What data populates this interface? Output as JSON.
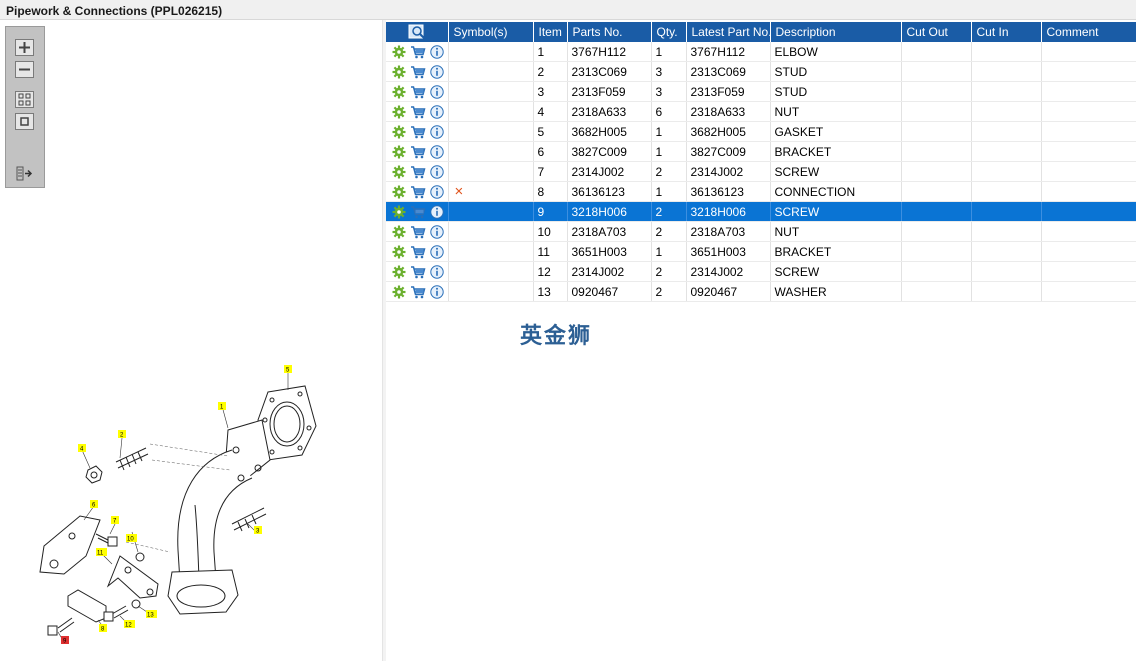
{
  "window": {
    "title": "Pipework & Connections (PPL026215)"
  },
  "toolbar": {
    "zoom_in_icon": "plus-icon",
    "zoom_out_icon": "minus-icon",
    "fit_icon": "grid-icon",
    "actual_icon": "square-icon",
    "export_icon": "export-icon"
  },
  "grid": {
    "headers": [
      "",
      "Symbol(s)",
      "Item",
      "Parts No.",
      "Qty.",
      "Latest Part No.",
      "Description",
      "Cut Out",
      "Cut In",
      "Comment"
    ],
    "rows": [
      {
        "symbol": "",
        "item": "1",
        "part": "3767H112",
        "qty": "1",
        "latest": "3767H112",
        "desc": "ELBOW"
      },
      {
        "symbol": "",
        "item": "2",
        "part": "2313C069",
        "qty": "3",
        "latest": "2313C069",
        "desc": "STUD"
      },
      {
        "symbol": "",
        "item": "3",
        "part": "2313F059",
        "qty": "3",
        "latest": "2313F059",
        "desc": "STUD"
      },
      {
        "symbol": "",
        "item": "4",
        "part": "2318A633",
        "qty": "6",
        "latest": "2318A633",
        "desc": "NUT"
      },
      {
        "symbol": "",
        "item": "5",
        "part": "3682H005",
        "qty": "1",
        "latest": "3682H005",
        "desc": "GASKET"
      },
      {
        "symbol": "",
        "item": "6",
        "part": "3827C009",
        "qty": "1",
        "latest": "3827C009",
        "desc": "BRACKET"
      },
      {
        "symbol": "",
        "item": "7",
        "part": "2314J002",
        "qty": "2",
        "latest": "2314J002",
        "desc": "SCREW"
      },
      {
        "symbol": "×",
        "item": "8",
        "part": "36136123",
        "qty": "1",
        "latest": "36136123",
        "desc": "CONNECTION"
      },
      {
        "symbol": "",
        "item": "9",
        "part": "3218H006",
        "qty": "2",
        "latest": "3218H006",
        "desc": "SCREW"
      },
      {
        "symbol": "",
        "item": "10",
        "part": "2318A703",
        "qty": "2",
        "latest": "2318A703",
        "desc": "NUT"
      },
      {
        "symbol": "",
        "item": "11",
        "part": "3651H003",
        "qty": "1",
        "latest": "3651H003",
        "desc": "BRACKET"
      },
      {
        "symbol": "",
        "item": "12",
        "part": "2314J002",
        "qty": "2",
        "latest": "2314J002",
        "desc": "SCREW"
      },
      {
        "symbol": "",
        "item": "13",
        "part": "0920467",
        "qty": "2",
        "latest": "0920467",
        "desc": "WASHER"
      }
    ],
    "selected_item": "9",
    "row_icons": [
      "settings-icon",
      "cart-icon",
      "info-icon"
    ],
    "colors": {
      "header": "#1a5ca6",
      "selected": "#0a74d4",
      "symbol_x": "#e0531b"
    }
  },
  "watermark": "英金狮",
  "callouts": [
    "1",
    "2",
    "3",
    "4",
    "5",
    "6",
    "7",
    "8",
    "9",
    "10",
    "11",
    "12",
    "13"
  ]
}
